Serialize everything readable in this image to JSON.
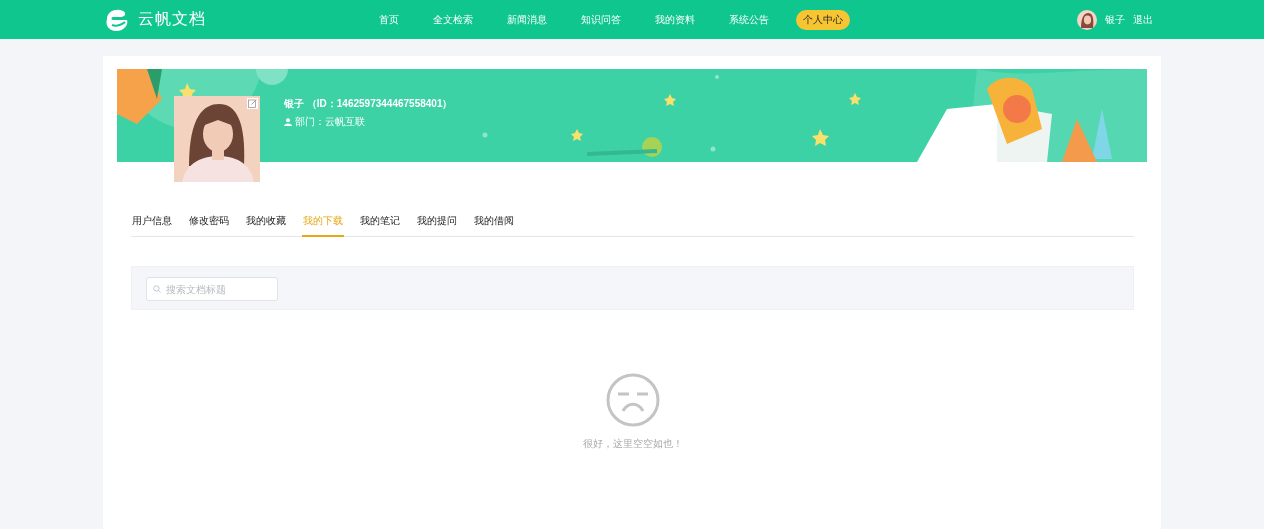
{
  "header": {
    "logo": "云帆文档",
    "nav": [
      {
        "label": "首页",
        "selected": false
      },
      {
        "label": "全文检索",
        "selected": false
      },
      {
        "label": "新闻消息",
        "selected": false
      },
      {
        "label": "知识问答",
        "selected": false
      },
      {
        "label": "我的资料",
        "selected": false
      },
      {
        "label": "系统公告",
        "selected": false
      },
      {
        "label": "个人中心",
        "selected": true
      }
    ],
    "user_name": "银子",
    "logout": "退出"
  },
  "profile": {
    "name": "银子 （ID：1462597344467558401）",
    "department": "部门：云帆互联"
  },
  "tabs": [
    {
      "label": "用户信息",
      "selected": false
    },
    {
      "label": "修改密码",
      "selected": false
    },
    {
      "label": "我的收藏",
      "selected": false
    },
    {
      "label": "我的下载",
      "selected": true
    },
    {
      "label": "我的笔记",
      "selected": false
    },
    {
      "label": "我的提问",
      "selected": false
    },
    {
      "label": "我的借阅",
      "selected": false
    }
  ],
  "search": {
    "placeholder": "搜索文档标题"
  },
  "empty": {
    "message": "很好，这里空空如也！"
  }
}
